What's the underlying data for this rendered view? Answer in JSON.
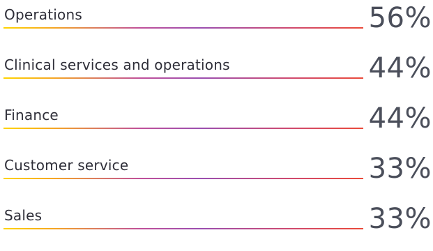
{
  "chart_data": {
    "type": "bar",
    "categories": [
      "Operations",
      "Clinical services and operations",
      "Finance",
      "Customer service",
      "Sales"
    ],
    "values": [
      56,
      44,
      44,
      33,
      33
    ],
    "value_labels": [
      "56%",
      "44%",
      "44%",
      "33%",
      "33%"
    ],
    "unit": "%"
  },
  "colors": {
    "label_text": "#2e2e38",
    "value_text": "#4a4e5a",
    "rule_gradient": [
      "#ffd400",
      "#f5a623",
      "#c0509a",
      "#9b4fb0",
      "#d04a6e",
      "#ea4a3a"
    ]
  }
}
